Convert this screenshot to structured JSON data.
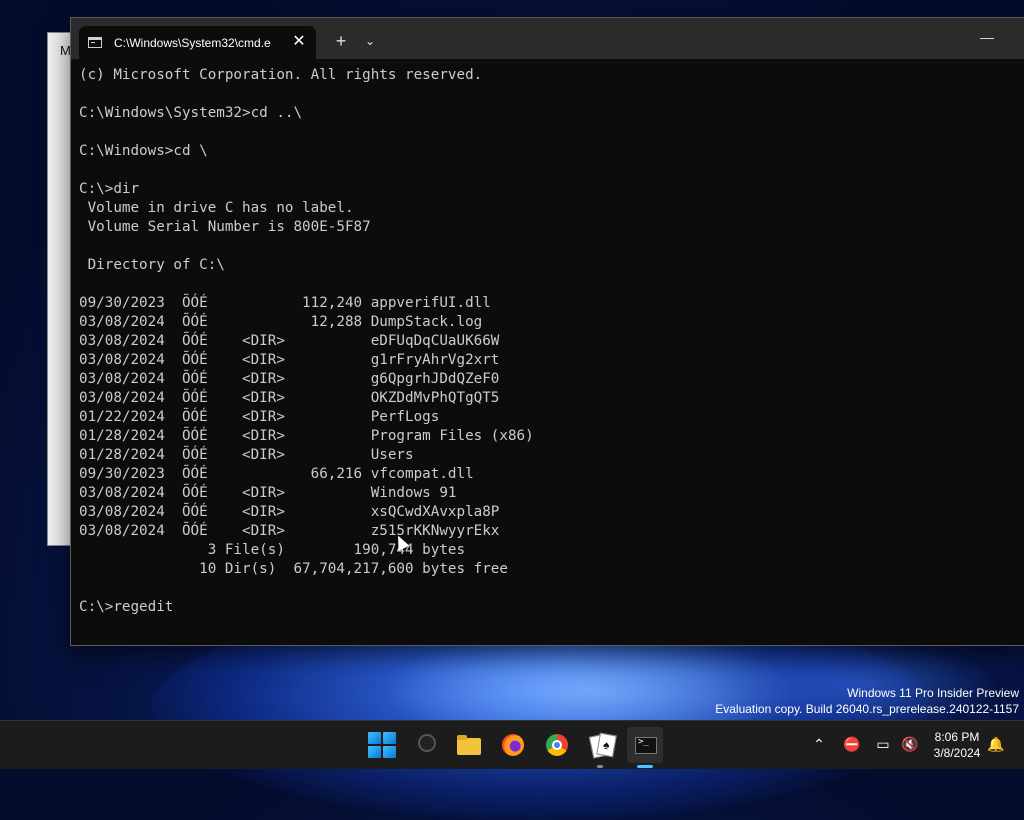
{
  "desktop": {
    "watermark": {
      "line1": "Windows 11 Pro Insider Preview",
      "line2": "Evaluation copy. Build 26040.rs_prerelease.240122-1157"
    },
    "back_window_letter": "M"
  },
  "terminal": {
    "tab_title": "C:\\Windows\\System32\\cmd.e",
    "close_glyph": "✕",
    "new_tab_glyph": "+",
    "dropdown_glyph": "⌄",
    "minimize_glyph": "—",
    "lines": [
      "(c) Microsoft Corporation. All rights reserved.",
      "",
      "C:\\Windows\\System32>cd ..\\",
      "",
      "C:\\Windows>cd \\",
      "",
      "C:\\>dir",
      " Volume in drive C has no label.",
      " Volume Serial Number is 800E-5F87",
      "",
      " Directory of C:\\",
      "",
      "09/30/2023  ÕÓÉ           112,240 appverifUI.dll",
      "03/08/2024  ÕÓÉ            12,288 DumpStack.log",
      "03/08/2024  ÕÓÉ    <DIR>          eDFUqDqCUaUK66W",
      "03/08/2024  ÕÓÉ    <DIR>          g1rFryAhrVg2xrt",
      "03/08/2024  ÕÓÉ    <DIR>          g6QpgrhJDdQZeF0",
      "03/08/2024  ÕÓÉ    <DIR>          OKZDdMvPhQTgQT5",
      "01/22/2024  ÕÓÉ    <DIR>          PerfLogs",
      "01/28/2024  ÕÓÉ    <DIR>          Program Files (x86)",
      "01/28/2024  ÕÓÉ    <DIR>          Users",
      "09/30/2023  ÕÓÉ            66,216 vfcompat.dll",
      "03/08/2024  ÕÓÉ    <DIR>          Windows 91",
      "03/08/2024  ÕÓÉ    <DIR>          xsQCwdXAvxpla8P",
      "03/08/2024  ÕÓÉ    <DIR>          z515rKKNwyyrEkx",
      "               3 File(s)        190,744 bytes",
      "              10 Dir(s)  67,704,217,600 bytes free",
      "",
      "C:\\>regedit"
    ]
  },
  "taskbar": {
    "apps": [
      "start-button",
      "search",
      "file-explorer",
      "firefox",
      "chrome",
      "solitaire",
      "terminal"
    ],
    "tray": {
      "chevron": "⌃",
      "network": "⛔",
      "display": "▭",
      "volume": "🔇",
      "bell": "🔔"
    },
    "time": "8:06 PM",
    "date": "3/8/2024",
    "accent": "#4cc2ff"
  }
}
